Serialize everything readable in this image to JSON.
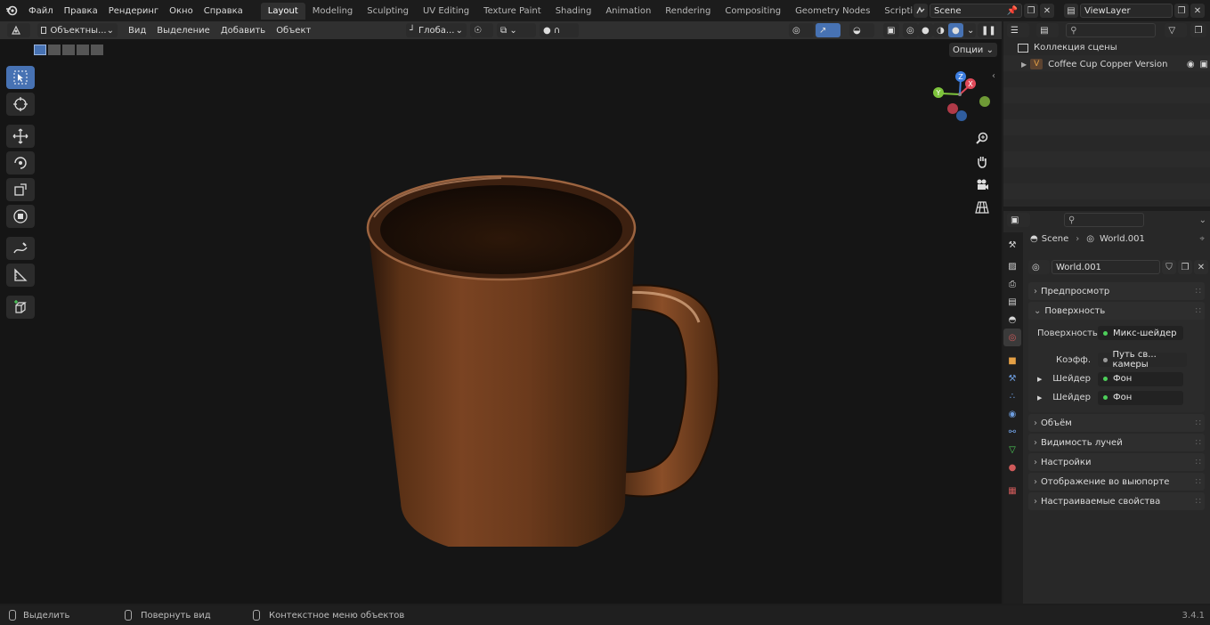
{
  "topbar": {
    "menus": [
      "Файл",
      "Правка",
      "Рендеринг",
      "Окно",
      "Справка"
    ],
    "workspaces": [
      "Layout",
      "Modeling",
      "Sculpting",
      "UV Editing",
      "Texture Paint",
      "Shading",
      "Animation",
      "Rendering",
      "Compositing",
      "Geometry Nodes",
      "Scripting"
    ],
    "active_workspace": "Layout",
    "add_tab": "+",
    "scene": "Scene",
    "view_layer": "ViewLayer"
  },
  "viewport_header": {
    "mode": "Объектны...",
    "menus": [
      "Вид",
      "Выделение",
      "Добавить",
      "Объект"
    ],
    "transform_orientation": "Глоба...",
    "options": "Опции"
  },
  "navigation_gizmo": {
    "axes": [
      "Z",
      "Y",
      "X"
    ]
  },
  "outliner": {
    "collection": "Коллекция сцены",
    "object": "Coffee Cup Copper Version"
  },
  "properties": {
    "breadcrumb": {
      "scene": "Scene",
      "world": "World.001"
    },
    "world_name": "World.001",
    "panels": {
      "preview": "Предпросмотр",
      "surface": "Поверхность",
      "volume": "Объём",
      "ray_visibility": "Видимость лучей",
      "settings": "Настройки",
      "viewport_display": "Отображение во выюпорте",
      "custom_props": "Настраиваемые свойства"
    },
    "surface": {
      "surface_label": "Поверхность",
      "surface_value": "Микс-шейдер",
      "fac_label": "Коэфф.",
      "fac_value": "Путь св... камеры",
      "shader1_label": "Шейдер",
      "shader1_value": "Фон",
      "shader2_label": "Шейдер",
      "shader2_value": "Фон"
    }
  },
  "statusbar": {
    "select": "Выделить",
    "rotate": "Повернуть вид",
    "context": "Контекстное меню объектов",
    "version": "3.4.1"
  },
  "colors": {
    "accent": "#4772b3",
    "active_object": "#e5a045",
    "green_socket": "#4dcf5a",
    "copper": "#7a4322"
  }
}
